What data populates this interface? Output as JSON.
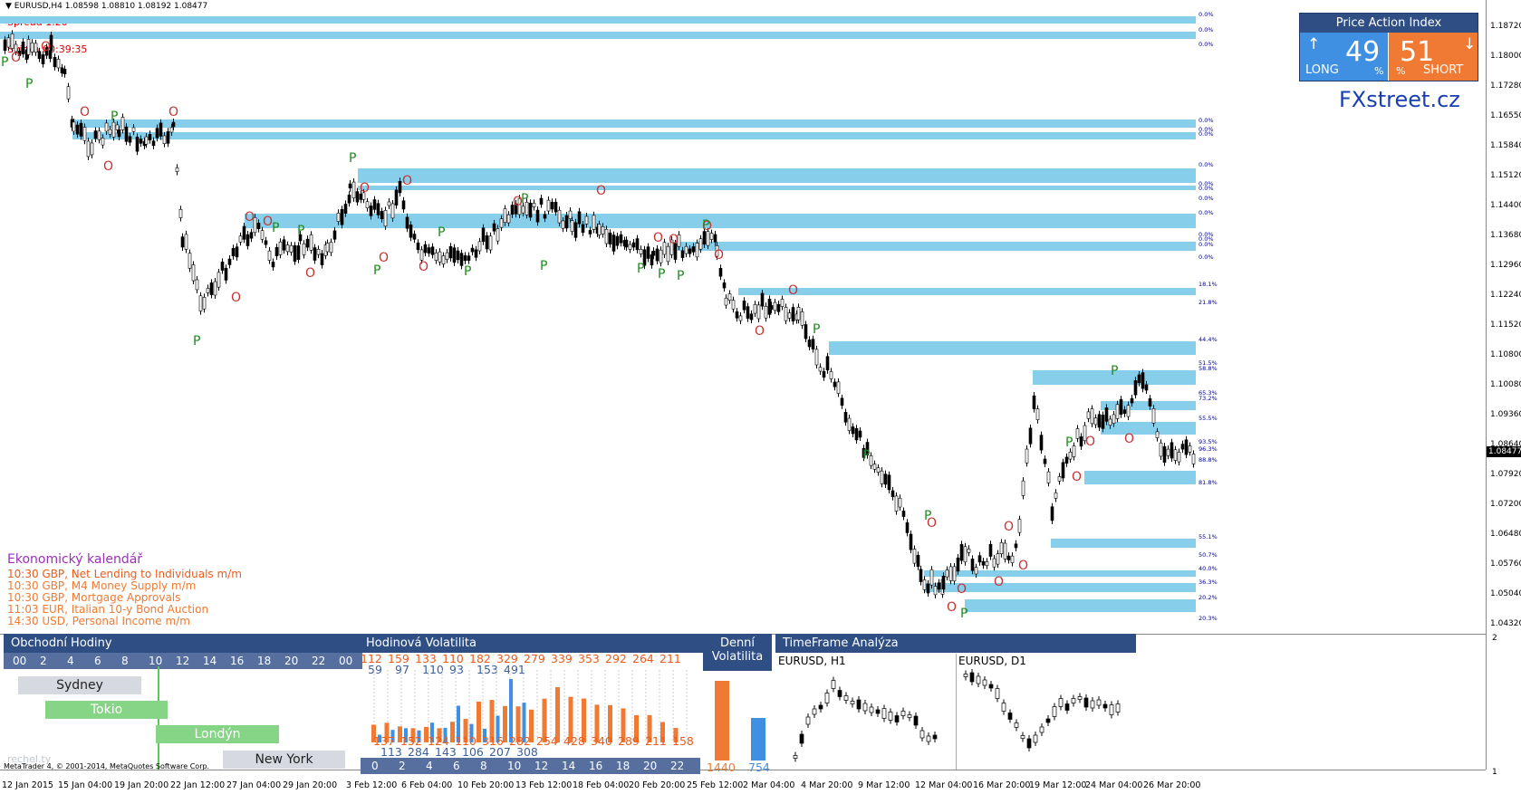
{
  "header": {
    "symbol": "EURUSD,H4  1.08598 1.08810 1.08192 1.08477",
    "spread": "Spread  1.20",
    "swaps": "Swaps  -3.60 -1.40",
    "svicka": "Svicka  00:39:35"
  },
  "price_axis": {
    "labels": [
      "1.18720",
      "1.18000",
      "1.17280",
      "1.16550",
      "1.15840",
      "1.15120",
      "1.14400",
      "1.13680",
      "1.12960",
      "1.12240",
      "1.11520",
      "1.10800",
      "1.10080",
      "1.09360",
      "1.08640",
      "1.07920",
      "1.07200",
      "1.06480",
      "1.05760",
      "1.05040",
      "1.04320"
    ],
    "current": "1.08477",
    "sub_top": "2",
    "sub_bottom": "1"
  },
  "fib_labels": [
    "0.0%",
    "0.0%",
    "0.0%",
    "0.0%",
    "0.0%",
    "0.0%",
    "0.0%",
    "0.0%",
    "0.0%",
    "0.0%",
    "0.0%",
    "0.0%",
    "0.0%",
    "0.0%",
    "0.0%",
    "18.1%",
    "21.8%",
    "44.4%",
    "51.5%",
    "58.8%",
    "65.3%",
    "73.2%",
    "55.5%",
    "93.5%",
    "96.3%",
    "88.8%",
    "81.8%",
    "55.1%",
    "50.7%",
    "40.0%",
    "36.3%",
    "20.2%",
    "20.3%"
  ],
  "price_action_index": {
    "title": "Price Action Index",
    "long_value": "49",
    "long_label": "LONG",
    "short_value": "51",
    "short_label": "SHORT",
    "pct": "%",
    "long_arrow": "↑",
    "short_arrow": "↓"
  },
  "brand": "FXstreet.cz",
  "calendar": {
    "title": "Ekonomický kalendář",
    "items": [
      {
        "text": "10:30 GBP, Net Lending to Individuals m/m",
        "color": "#ee5a1a"
      },
      {
        "text": "10:30 GBP, M4 Money Supply m/m",
        "color": "#f07a33"
      },
      {
        "text": "10:30 GBP, Mortgage Approvals",
        "color": "#f07a33"
      },
      {
        "text": "11:03 EUR, Italian 10-y Bond Auction",
        "color": "#f07a33"
      },
      {
        "text": "14:30 USD, Personal Income m/m",
        "color": "#f07a33"
      }
    ]
  },
  "trading_hours": {
    "title": "Obchodní Hodiny",
    "hours": [
      "00",
      "2",
      "4",
      "6",
      "8",
      "10",
      "12",
      "14",
      "16",
      "18",
      "20",
      "22",
      "00"
    ],
    "sessions": [
      {
        "name": "Sydney",
        "color": "#d6dae0"
      },
      {
        "name": "Tokio",
        "color": "#86d486"
      },
      {
        "name": "Londýn",
        "color": "#86d486"
      },
      {
        "name": "New York",
        "color": "#d6dae0"
      }
    ],
    "footer": "MetaTrader 4, © 2001-2014, MetaQuotes Software Corp.",
    "overlay": "rechel.ty"
  },
  "hourly_volatility": {
    "title": "Hodinová Volatilita",
    "top_orange": [
      "112",
      "159",
      "133",
      "110",
      "182",
      "329",
      "279",
      "339",
      "353",
      "292",
      "264",
      "211"
    ],
    "top_blue": [
      "59",
      "97",
      "110",
      "93",
      "153",
      "491"
    ],
    "bottom_orange": [
      "137",
      "152",
      "124",
      "110",
      "316",
      "282",
      "254",
      "428",
      "340",
      "289",
      "211",
      "158"
    ],
    "bottom_blue": [
      "113",
      "284",
      "143",
      "106",
      "207",
      "308"
    ],
    "hours": [
      "0",
      "2",
      "4",
      "6",
      "8",
      "10",
      "12",
      "14",
      "16",
      "18",
      "20",
      "22"
    ]
  },
  "daily_volatility": {
    "title_line1": "Denní",
    "title_line2": "Volatilita",
    "value_orange": "1440",
    "value_blue": "754"
  },
  "timeframe_analysis": {
    "title": "TimeFrame Analýza",
    "left_label": "EURUSD, H1",
    "right_label": "EURUSD, D1"
  },
  "x_axis": [
    "12 Jan 2015",
    "15 Jan 04:00",
    "19 Jan 20:00",
    "22 Jan 12:00",
    "27 Jan 04:00",
    "29 Jan 20:00",
    "3 Feb 12:00",
    "6 Feb 04:00",
    "10 Feb 20:00",
    "13 Feb 12:00",
    "18 Feb 04:00",
    "20 Feb 20:00",
    "25 Feb 12:00",
    "2 Mar 04:00",
    "4 Mar 20:00",
    "9 Mar 12:00",
    "12 Mar 04:00",
    "16 Mar 20:00",
    "19 Mar 12:00",
    "24 Mar 04:00",
    "26 Mar 20:00"
  ],
  "colors": {
    "band": "#87ceeb",
    "bull": "#1e8b1e",
    "bear": "#c83232",
    "panel": "#2f4f84",
    "long": "#3f8fe3",
    "short": "#f07a33"
  }
}
